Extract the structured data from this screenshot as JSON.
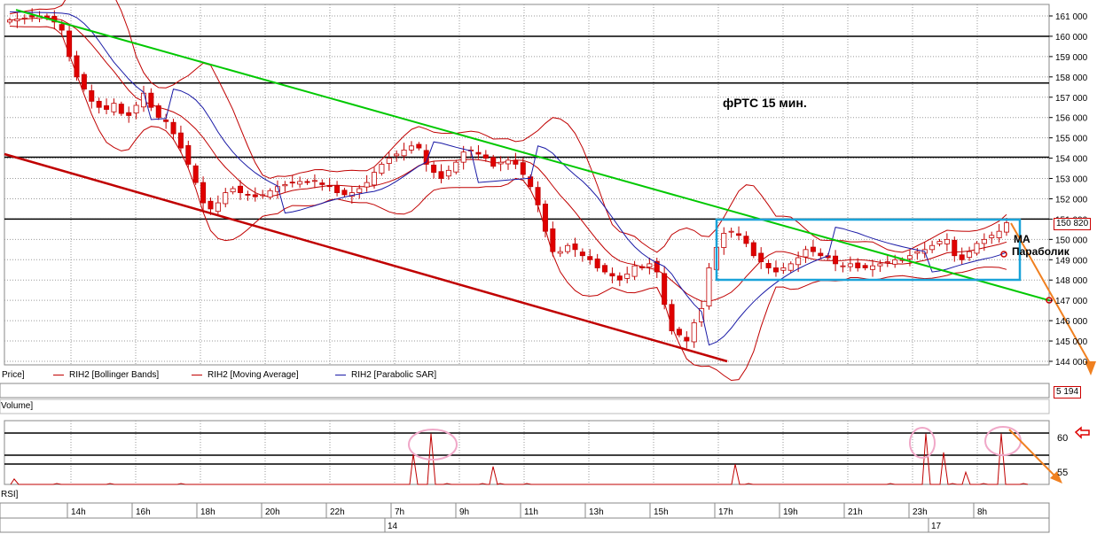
{
  "title": "фРТС   15 мин.",
  "annotations": {
    "ma": "MA",
    "parabolic": "Параболик"
  },
  "legend": {
    "price": "Price]",
    "items": [
      {
        "label": "RIH2 [Bollinger Bands]",
        "color": "#c00000"
      },
      {
        "label": "RIH2 [Moving Average]",
        "color": "#c00000"
      },
      {
        "label": "RIH2 [Parabolic SAR]",
        "color": "#1a1aa6"
      }
    ]
  },
  "panes": {
    "volume_label": "Volume]",
    "rsi_label": "RSI]"
  },
  "current_price_label": "150 820",
  "volume_value_label": "5 194",
  "chart_data": {
    "type": "candlestick",
    "price_axis": {
      "min": 144000,
      "max": 161000,
      "ticks": [
        "161 000",
        "160 000",
        "159 000",
        "158 000",
        "157 000",
        "156 000",
        "155 000",
        "154 000",
        "153 000",
        "152 000",
        "151 000",
        "150 000",
        "149 000",
        "148 000",
        "147 000",
        "146 000",
        "145 000",
        "144 000"
      ]
    },
    "x_axis": {
      "time_labels": [
        "14h",
        "16h",
        "18h",
        "20h",
        "22h",
        "7h",
        "9h",
        "11h",
        "13h",
        "15h",
        "17h",
        "19h",
        "21h",
        "23h",
        "8h"
      ],
      "date_labels": [
        "14",
        "17"
      ]
    },
    "horizontal_levels": [
      160000,
      157700,
      154050,
      151000
    ],
    "closes": [
      160800,
      160850,
      160900,
      160950,
      161000,
      160900,
      160700,
      160300,
      159000,
      158000,
      157400,
      156800,
      156500,
      156400,
      156700,
      156200,
      156100,
      156600,
      157200,
      156500,
      156000,
      155800,
      155200,
      154500,
      153700,
      152800,
      151800,
      151500,
      151800,
      152300,
      152500,
      152300,
      152200,
      152100,
      152200,
      152400,
      152600,
      152700,
      152800,
      152850,
      152800,
      152900,
      152700,
      152600,
      152300,
      152200,
      152300,
      152500,
      152800,
      153300,
      153700,
      154000,
      154200,
      154400,
      154600,
      154500,
      153700,
      153300,
      153000,
      153400,
      153800,
      154300,
      154400,
      154200,
      154000,
      153600,
      153800,
      153900,
      153700,
      153200,
      152600,
      151700,
      150400,
      149400,
      149400,
      149700,
      149500,
      149200,
      149000,
      148600,
      148400,
      148200,
      148000,
      148300,
      148700,
      148600,
      148800,
      148400,
      146800,
      145500,
      145300,
      145000,
      145900,
      146600,
      148600,
      149600,
      150300,
      150400,
      150200,
      149800,
      149200,
      148900,
      148600,
      148400,
      148600,
      148800,
      149100,
      149500,
      149400,
      149200,
      149100,
      148800,
      148700,
      148800,
      148600,
      148600,
      148700,
      148800,
      148900,
      149000,
      149000,
      149200,
      149400,
      149500,
      149700,
      149900,
      150000,
      149200,
      149000,
      149400,
      149800,
      150000,
      150200,
      150400,
      150820
    ],
    "bollinger_upper_start": 161000,
    "moving_average_note": "red line",
    "parabolic_sar_note": "blue line",
    "trend_lines": [
      {
        "color": "#00c800",
        "from_price": 161300,
        "to_price": 147000
      },
      {
        "color": "#c00000",
        "from_price": 154200,
        "to_price": 144000
      }
    ],
    "rsi_axis": {
      "ticks": [
        "60",
        "55"
      ],
      "levels": [
        61,
        57,
        55
      ]
    },
    "rsi_spikes": [
      0.08,
      0.0,
      0.0,
      0.0,
      0.52,
      0.88,
      0.0,
      0.0,
      0.3,
      0.0,
      0.0,
      0.34,
      0.0,
      0.0,
      0.88,
      0.55,
      0.0,
      0.2,
      0.0,
      0.88,
      0.0
    ]
  }
}
